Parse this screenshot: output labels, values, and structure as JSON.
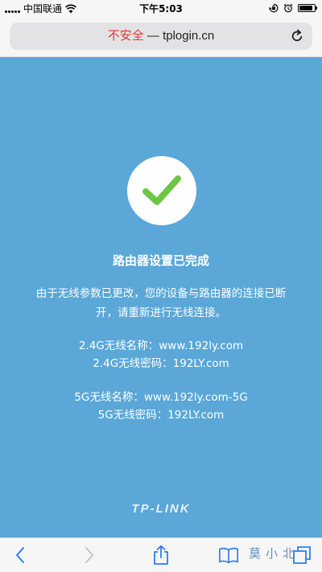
{
  "status_bar": {
    "carrier": "中国联通",
    "time": "下午5:03",
    "battery_level": 0.9
  },
  "address_bar": {
    "security_label": "不安全",
    "separator": " — ",
    "domain": "tplogin.cn"
  },
  "content": {
    "title": "路由器设置已完成",
    "message": "由于无线参数已更改，您的设备与路由器的连接已断开，请重新进行无线连接。",
    "wifi_24g": {
      "name_line": "2.4G无线名称：www.192ly.com",
      "password_line": "2.4G无线密码：192LY.com"
    },
    "wifi_5g": {
      "name_line": "5G无线名称：www.192ly.com-5G",
      "password_line": "5G无线密码：192LY.com"
    },
    "logo_text": "TP-LINK"
  },
  "toolbar": {
    "icons": [
      "back-icon",
      "forward-icon",
      "share-icon",
      "bookmarks-icon",
      "tabs-icon"
    ]
  },
  "watermark": "莫小北",
  "colors": {
    "background": "#5aa7d8",
    "check": "#6cc644",
    "insecure": "#e3342f",
    "toolbar_icon": "#2f7cf6"
  }
}
